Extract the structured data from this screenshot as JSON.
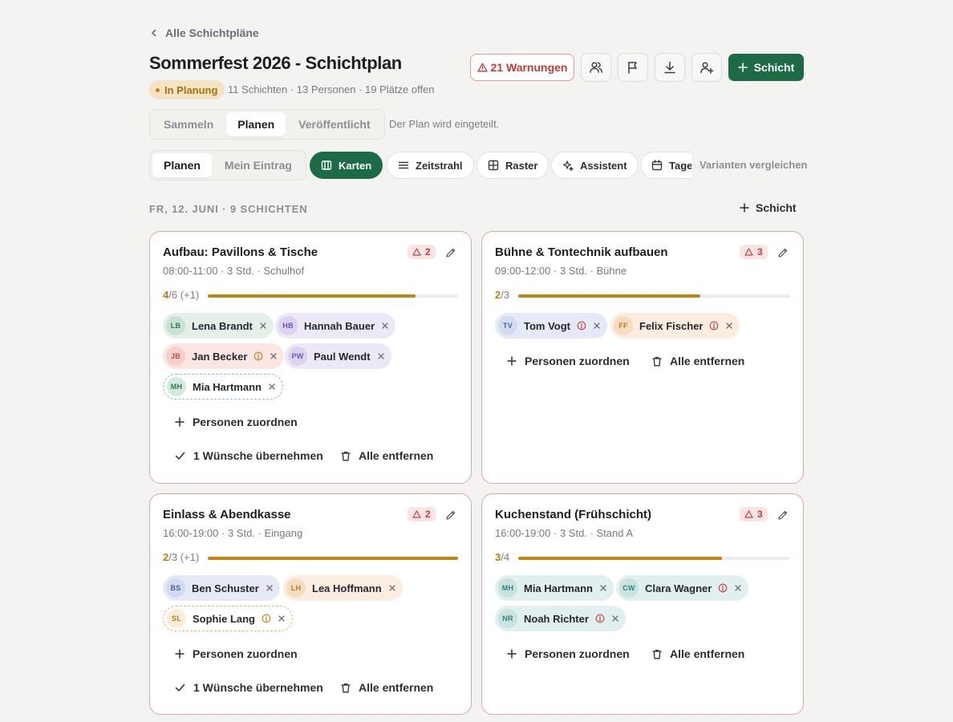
{
  "back_label": "Alle Schichtpläne",
  "title": "Sommerfest 2026 - Schichtplan",
  "status": "In Planung",
  "meta": "11 Schichten · 13 Personen · 19 Plätze offen",
  "warnings_label": "21 Warnungen",
  "add_shift_label": "Schicht",
  "phase_tabs": [
    "Sammeln",
    "Planen",
    "Veröffentlicht"
  ],
  "phase_note": "Der Plan wird eingeteilt.",
  "mode_tabs": [
    "Planen",
    "Mein Eintrag"
  ],
  "views": [
    "Karten",
    "Zeitstrahl",
    "Raster",
    "Assistent",
    "Tagesplan"
  ],
  "compare_label": "Varianten vergleichen",
  "day_header": "FR, 12. JUNI · 9 SCHICHTEN",
  "day_add_label": "Schicht",
  "actions": {
    "assign": "Personen zuordnen",
    "wishes": "1 Wünsche übernehmen",
    "remove": "Alle entfernen"
  },
  "colors": {
    "accent": "#1d6b46",
    "warning": "#c93e3e",
    "progress": "#c5830f"
  },
  "shifts": [
    {
      "title": "Aufbau: Pavillons & Tische",
      "sub": "08:00-11:00 · 3 Std. · Schulhof",
      "warnings": "2",
      "filled": "4",
      "rest": "/6 (+1)",
      "progress": 0.83,
      "people": [
        {
          "initials": "LB",
          "name": "Lena Brandt"
        },
        {
          "initials": "HB",
          "name": "Hannah Bauer"
        },
        {
          "initials": "JB",
          "name": "Jan Becker"
        },
        {
          "initials": "PW",
          "name": "Paul Wendt"
        },
        {
          "initials": "MH",
          "name": "Mia Hartmann"
        }
      ]
    },
    {
      "title": "Bühne & Tontechnik aufbauen",
      "sub": "09:00-12:00 · 3 Std. · Bühne",
      "warnings": "3",
      "filled": "2",
      "rest": "/3",
      "progress": 0.67,
      "people": [
        {
          "initials": "TV",
          "name": "Tom Vogt"
        },
        {
          "initials": "FF",
          "name": "Felix Fischer"
        }
      ]
    },
    {
      "title": "Einlass & Abendkasse",
      "sub": "16:00-19:00 · 3 Std. · Eingang",
      "warnings": "2",
      "filled": "2",
      "rest": "/3 (+1)",
      "progress": 1.0,
      "people": [
        {
          "initials": "BS",
          "name": "Ben Schuster"
        },
        {
          "initials": "LH",
          "name": "Lea Hoffmann"
        },
        {
          "initials": "SL",
          "name": "Sophie Lang"
        }
      ]
    },
    {
      "title": "Kuchenstand (Frühschicht)",
      "sub": "16:00-19:00 · 3 Std. · Stand A",
      "warnings": "3",
      "filled": "3",
      "rest": "/4",
      "progress": 0.75,
      "people": [
        {
          "initials": "MH",
          "name": "Mia Hartmann"
        },
        {
          "initials": "CW",
          "name": "Clara Wagner"
        },
        {
          "initials": "NR",
          "name": "Noah Richter"
        }
      ]
    }
  ]
}
